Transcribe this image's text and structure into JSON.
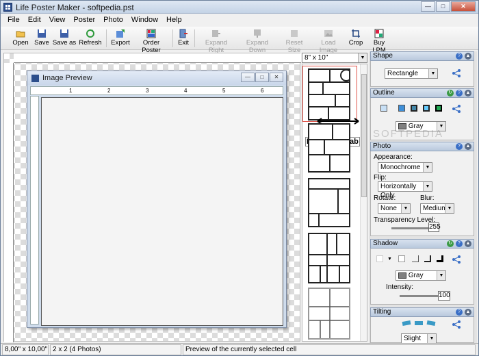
{
  "window": {
    "title": "Life Poster Maker - softpedia.pst"
  },
  "menu": [
    "File",
    "Edit",
    "View",
    "Poster",
    "Photo",
    "Window",
    "Help"
  ],
  "toolbar": {
    "open": "Open",
    "save": "Save",
    "save_as": "Save as",
    "refresh": "Refresh",
    "export": "Export",
    "order_poster": "Order Poster",
    "exit": "Exit",
    "expand_right": "Expand Right",
    "expand_down": "Expand Down",
    "reset_size": "Reset Size",
    "load_image": "Load Image",
    "crop": "Crop",
    "buy_lpm": "Buy LPM"
  },
  "preview": {
    "title": "Image Preview",
    "ruler": [
      "1",
      "2",
      "3",
      "4",
      "5",
      "6"
    ]
  },
  "layouts": {
    "size": "8\" x 10\"",
    "dimension_label": "DimensionLab"
  },
  "panels": {
    "shape": {
      "title": "Shape",
      "value": "Rectangle"
    },
    "outline": {
      "title": "Outline",
      "color": "Gray"
    },
    "photo": {
      "title": "Photo",
      "appearance_label": "Appearance:",
      "appearance": "Monochrome",
      "flip_label": "Flip:",
      "flip": "Horizontally Only",
      "rotate_label": "Rotate:",
      "rotate": "None",
      "blur_label": "Blur:",
      "blur": "Medium",
      "transparency_label": "Transparency Level:",
      "transparency": "255"
    },
    "shadow": {
      "title": "Shadow",
      "color": "Gray",
      "intensity_label": "Intensity:",
      "intensity": "100"
    },
    "tilting": {
      "title": "Tilting",
      "value": "Slight"
    }
  },
  "watermark": "SOFTPEDIA",
  "status": {
    "size": "8,00\" x 10,00\"",
    "layout": "2 x 2 (4 Photos)",
    "message": "Preview of the currently selected cell"
  },
  "colors": {
    "accent": "#2d4f8c",
    "selection": "#e0554b"
  }
}
